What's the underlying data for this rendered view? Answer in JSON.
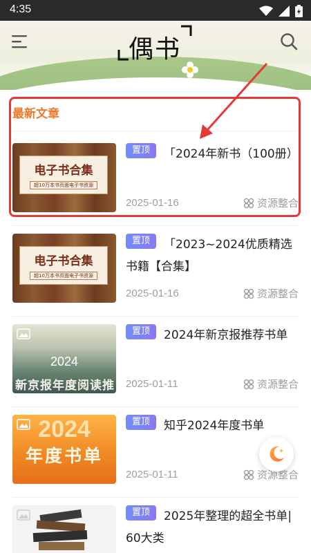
{
  "status": {
    "time": "4:35"
  },
  "header": {
    "logo_text": "偶书"
  },
  "section": {
    "title": "最新文章"
  },
  "pin_label": "置顶",
  "source_label": "资源整合",
  "articles": [
    {
      "title": "「2024年新书（100册）",
      "date": "2025-01-16",
      "thumb": {
        "big": "电子书合集",
        "small": "超10万本书页面电子书资源"
      }
    },
    {
      "title": "「2023~2024优质精选书籍【合集】",
      "date": "2025-01-16",
      "thumb": {
        "big": "电子书合集",
        "small": "超10万本书页面电子书资源"
      }
    },
    {
      "title": "2024年新京报推荐书单",
      "date": "2025-01-11",
      "thumb": {
        "year": "2024",
        "caption": "新京报年度阅读推"
      }
    },
    {
      "title": "知乎2024年度书单",
      "date": "2025-01-11",
      "thumb": {
        "year": "2024",
        "caption": "年度书单"
      }
    },
    {
      "title": "2025年整理的超全书单| 60大类",
      "date": "",
      "thumb": {}
    }
  ]
}
